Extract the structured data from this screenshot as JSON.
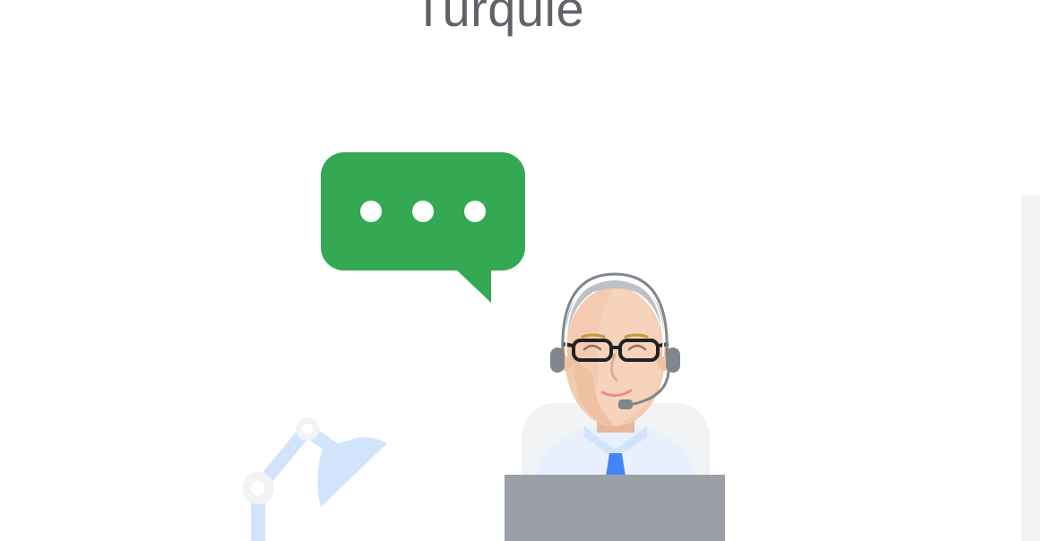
{
  "page": {
    "title": "Turquie"
  },
  "illustration": {
    "colors": {
      "chat_bubble": "#34a853",
      "dots": "#ffffff",
      "lamp": "#d2e3fc",
      "laptop": "#9aa0a6",
      "chair": "#f1f3f4",
      "shirt": "#e8f0fe",
      "tie": "#4285f4",
      "skin": "#f4cbb0",
      "headset": "#80868b",
      "glasses": "#202124",
      "panel": "#f1f3f4"
    }
  }
}
